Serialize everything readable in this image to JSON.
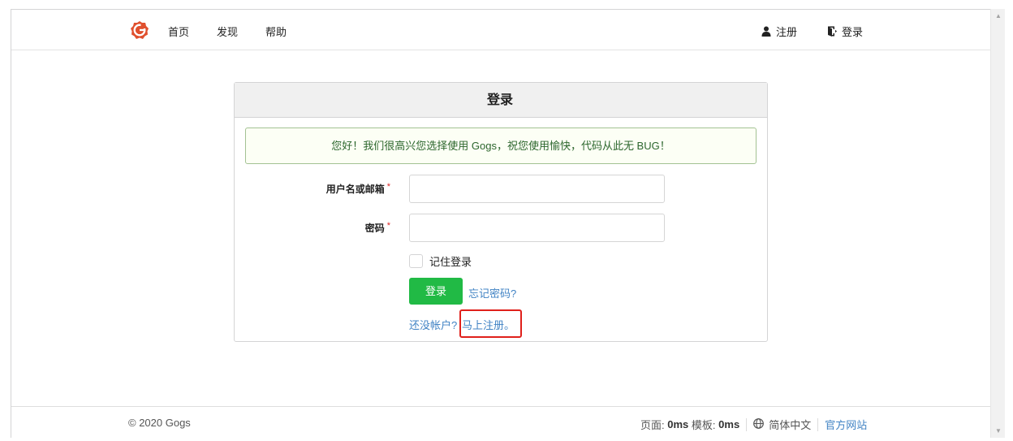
{
  "header": {
    "nav": {
      "home": "首页",
      "explore": "发现",
      "help": "帮助",
      "register": "注册",
      "login": "登录"
    }
  },
  "panel": {
    "title": "登录",
    "alert": "您好！我们很高兴您选择使用 Gogs，祝您使用愉快，代码从此无 BUG！",
    "username_label": "用户名或邮箱",
    "password_label": "密码",
    "required_mark": "*",
    "username_value": "",
    "password_value": "",
    "remember_label": "记住登录",
    "remember_checked": false,
    "login_button": "登录",
    "forgot_link": "忘记密码?",
    "no_account_text": "还没帐户?",
    "signup_link": "马上注册。"
  },
  "footer": {
    "copyright": "© 2020 Gogs",
    "page_label": "页面:",
    "page_time": "0ms",
    "template_label": "模板:",
    "template_time": "0ms",
    "language": "简体中文",
    "official_site": "官方网站"
  },
  "colors": {
    "brand": "#e0502e",
    "primary_button": "#21ba45",
    "link": "#4183c4",
    "alert_bg": "#fcfff5",
    "alert_text": "#2c662d",
    "highlight_box": "#e0201b"
  },
  "icons": {
    "logo": "gogs-logo-icon",
    "register": "user-icon",
    "login": "sign-in-icon",
    "language": "globe-icon"
  }
}
